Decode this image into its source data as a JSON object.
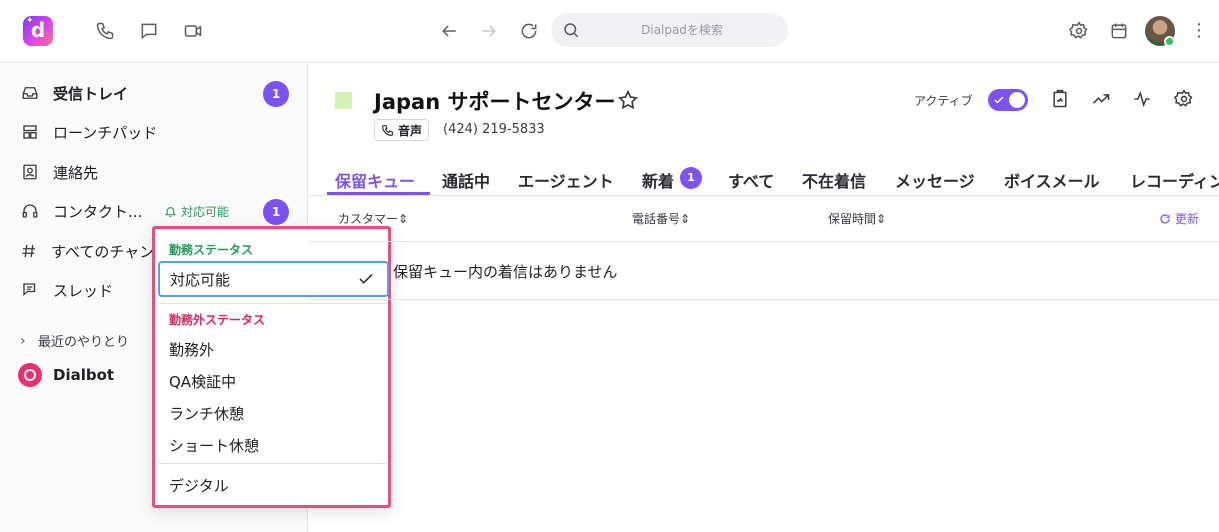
{
  "app": {
    "logo_letter": "d",
    "brand_color": "#7c52f5"
  },
  "topbar": {
    "search_placeholder": "Dialpadを検索",
    "icons": [
      "phone-icon",
      "message-icon",
      "video-icon",
      "back-icon",
      "forward-icon",
      "reload-icon",
      "search-icon",
      "gear-icon",
      "calendar-icon",
      "avatar",
      "more-icon"
    ],
    "more_glyph": "⋮"
  },
  "sidebar": {
    "items": [
      {
        "label": "受信トレイ",
        "badge": "1"
      },
      {
        "label": "ローンチパッド"
      },
      {
        "label": "連絡先"
      },
      {
        "label": "コンタクト...",
        "badge": "1",
        "status": "対応可能"
      },
      {
        "label": "すべてのチャンネル"
      },
      {
        "label": "スレッド"
      }
    ],
    "recent_label": "最近のやりとり",
    "dialbot_label": "Dialbot"
  },
  "dropdown": {
    "on_duty_header": "勤務ステータス",
    "selected": "対応可能",
    "off_duty_header": "勤務外ステータス",
    "off_duty_items": [
      "勤務外",
      "QA検証中",
      "ランチ休憩",
      "ショート休憩"
    ],
    "digital": "デジタル"
  },
  "main": {
    "queue_color": "#cff5b0",
    "title": "Japan サポートセンター",
    "voice_label": "音声",
    "phone": "(424) 219-5833",
    "active_label": "アクティブ",
    "tabs": [
      {
        "label": "保留キュー"
      },
      {
        "label": "通話中"
      },
      {
        "label": "エージェント"
      },
      {
        "label": "新着",
        "badge": "1"
      },
      {
        "label": "すべて"
      },
      {
        "label": "不在着信"
      },
      {
        "label": "メッセージ"
      },
      {
        "label": "ボイスメール"
      },
      {
        "label": "レコーディング"
      }
    ],
    "columns": [
      "カスタマー",
      "電話番号",
      "保留時間"
    ],
    "refresh_label": "更新",
    "empty_message": "保留キュー内の着信はありません"
  }
}
